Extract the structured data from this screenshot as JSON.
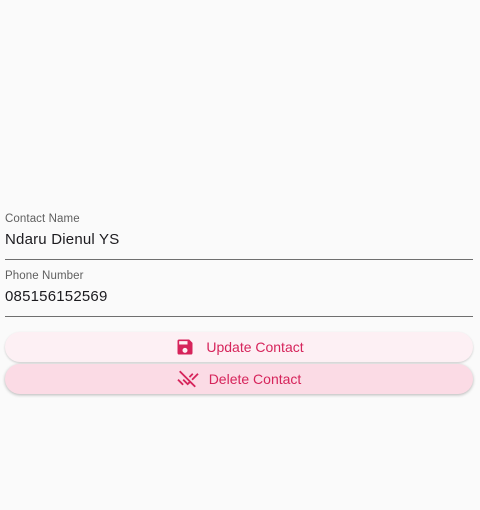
{
  "form": {
    "contact_name": {
      "label": "Contact Name",
      "value": "Ndaru Dienul YS"
    },
    "phone_number": {
      "label": "Phone Number",
      "value": "085156152569"
    }
  },
  "actions": {
    "update": {
      "label": "Update Contact",
      "icon": "save-icon"
    },
    "delete": {
      "label": "Delete Contact",
      "icon": "remove-done-icon"
    }
  },
  "colors": {
    "accent": "#d6245b",
    "update_bg": "#fdf0f4",
    "delete_bg": "#fbdbe5",
    "page_bg": "#fafafa"
  }
}
